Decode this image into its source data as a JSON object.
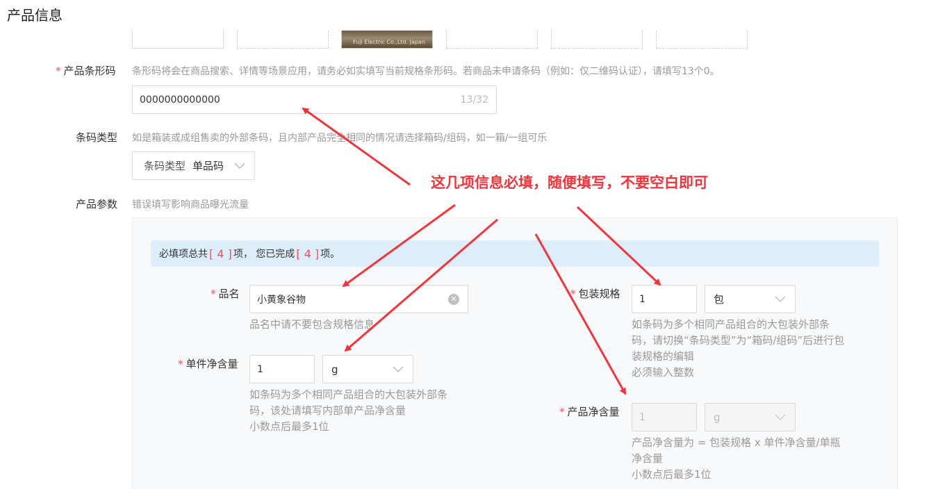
{
  "section": {
    "title": "产品信息"
  },
  "thumb": {
    "image_caption": "Fuji Electric Co.,Ltd. Japan"
  },
  "barcode": {
    "label": "产品条形码",
    "required_mark": "*",
    "hint": "条形码将会在商品搜索、详情等场景应用，请务必如实填写当前规格条形码。若商品未申请条码（例如：仅二维码认证），请填写13个0。",
    "value": "0000000000000",
    "counter": "13/32"
  },
  "barcode_type": {
    "label": "条码类型",
    "hint": "如是箱装或成组售卖的外部条码，且内部产品完全相同的情况请选择箱码/组码，如一箱/一组可乐",
    "select_prefix": "条码类型",
    "selected": "单品码"
  },
  "params": {
    "label": "产品参数",
    "hint": "错误填写影响商品曝光流量",
    "banner": {
      "prefix": "必填项总共",
      "total": "[ 4 ]",
      "middle": "项， 您已完成",
      "done": "[ 4 ]",
      "suffix": "项。"
    },
    "name": {
      "label": "品名",
      "required_mark": "*",
      "value": "小黄象谷物",
      "hint": "品名中请不要包含规格信息"
    },
    "package": {
      "label": "包装规格",
      "required_mark": "*",
      "value": "1",
      "unit": "包",
      "hint_lines": [
        "如条码为多个相同产品组合的大包装外部条",
        "码，请切换“条码类型”为“箱码/组码”后进行包",
        "装规格的编辑",
        "必须输入整数"
      ]
    },
    "unit_net": {
      "label": "单件净含量",
      "required_mark": "*",
      "value": "1",
      "unit": "g",
      "hint_lines": [
        "如条码为多个相同产品组合的大包装外部条",
        "码，该处请填写内部单产品净含量",
        "小数点后最多1位"
      ]
    },
    "net": {
      "label": "产品净含量",
      "required_mark": "*",
      "value": "1",
      "unit": "g",
      "hint_lines": [
        "产品净含量为 = 包装规格 x 单件净含量/单瓶",
        "净含量",
        "小数点后最多1位"
      ]
    }
  },
  "annotation": {
    "text": "这几项信息必填，随便填写，不要空白即可",
    "color": "#f5333a"
  },
  "colors": {
    "required": "#ff4d4f",
    "banner_bg": "#dcedfb",
    "hint": "#999999"
  }
}
